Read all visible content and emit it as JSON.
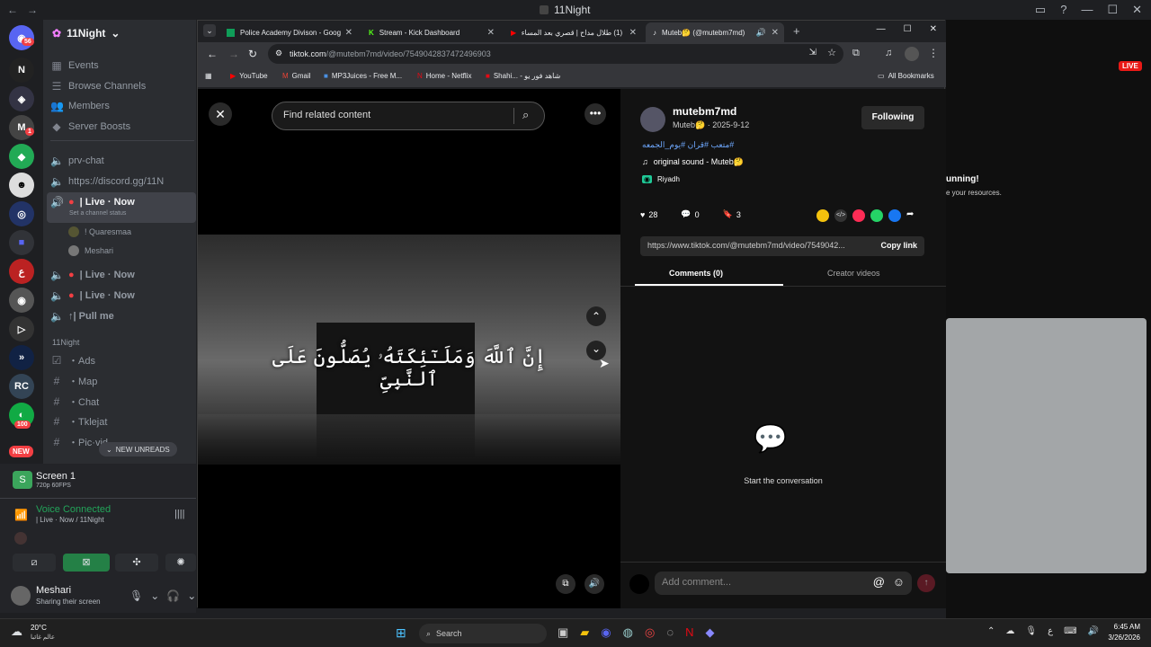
{
  "app": {
    "title": "11Night"
  },
  "rail": {
    "badges": [
      "56",
      "1",
      "100",
      "NEW"
    ]
  },
  "sidebar": {
    "server_name": "11Night",
    "menu": [
      {
        "label": "Events",
        "icon": "calendar-icon"
      },
      {
        "label": "Browse Channels",
        "icon": "browse-icon"
      },
      {
        "label": "Members",
        "icon": "members-icon"
      },
      {
        "label": "Server Boosts",
        "icon": "boost-icon"
      }
    ],
    "channels": [
      {
        "label": "prv-chat",
        "icon": "speaker-icon"
      },
      {
        "label": "https://discord.gg/11N",
        "icon": "speaker-icon"
      },
      {
        "label": "| Live · Now",
        "icon": "speaker-icon",
        "status": "Set a channel status"
      },
      {
        "label": "! Quaresmaa",
        "icon": "user-icon"
      },
      {
        "label": "Meshari",
        "icon": "user-icon"
      },
      {
        "label": "| Live · Now",
        "icon": "speaker-icon"
      },
      {
        "label": "| Live · Now",
        "icon": "speaker-icon"
      },
      {
        "label": "↑| Pull me",
        "icon": "speaker-icon"
      }
    ],
    "category": "11Night",
    "text_channels": [
      "・Ads",
      "・Map",
      "・Chat",
      "・Tklejat",
      "・Pic·vid"
    ],
    "new_unreads": "NEW UNREADS"
  },
  "voice": {
    "screen_title": "Screen 1",
    "screen_quality": "720p 60FPS",
    "connected": "Voice Connected",
    "channel": "| Live · Now / 11Night",
    "user_name": "Meshari",
    "user_status": "Sharing their screen"
  },
  "browser": {
    "tabs": [
      {
        "title": "Police Academy Divison - Goog"
      },
      {
        "title": "Stream - Kick Dashboard"
      },
      {
        "title": "(1) طلال مداح | قصري بعد المساء"
      },
      {
        "title": "Muteb🤔 (@mutebm7md)"
      }
    ],
    "url_host": "tiktok.com",
    "url_path": "/@mutebm7md/video/7549042837472496903",
    "bookmarks": [
      "YouTube",
      "Gmail",
      "MP3Juices - Free M...",
      "Home - Netflix",
      "Shahi... - شاهد فور يو"
    ],
    "all_bookmarks": "All Bookmarks"
  },
  "tiktok": {
    "search_placeholder": "Find related content",
    "username": "mutebm7md",
    "display_name": "Muteb🤔 · 2025-9-12",
    "follow_button": "Following",
    "hashtags": "#متعب #قران #يوم_الجمعه",
    "sound": "original sound - Muteb🤔",
    "location": "Riyadh",
    "likes": "28",
    "comments_count": "0",
    "saves": "3",
    "link": "https://www.tiktok.com/@mutebm7md/video/7549042...",
    "copy_link": "Copy link",
    "tab_comments": "Comments (0)",
    "tab_creator": "Creator videos",
    "empty_text": "Start the conversation",
    "comment_placeholder": "Add comment...",
    "caption": "إِنَّ ٱللَّهَ وَمَلَـٰٓئِكَتَهُۥ يُصَلُّونَ عَلَى ٱلنَّبِىِّ"
  },
  "right": {
    "live_badge": "LIVE",
    "running": "unning!",
    "resources": "e your resources."
  },
  "taskbar": {
    "temp": "20°C",
    "weather": "عالم غائبا",
    "search": "Search",
    "time": "6:45 AM",
    "date": "3/26/2026",
    "lang": "ع"
  },
  "colors": {
    "accent": "#fe2c55",
    "discord_green": "#23a55a"
  }
}
